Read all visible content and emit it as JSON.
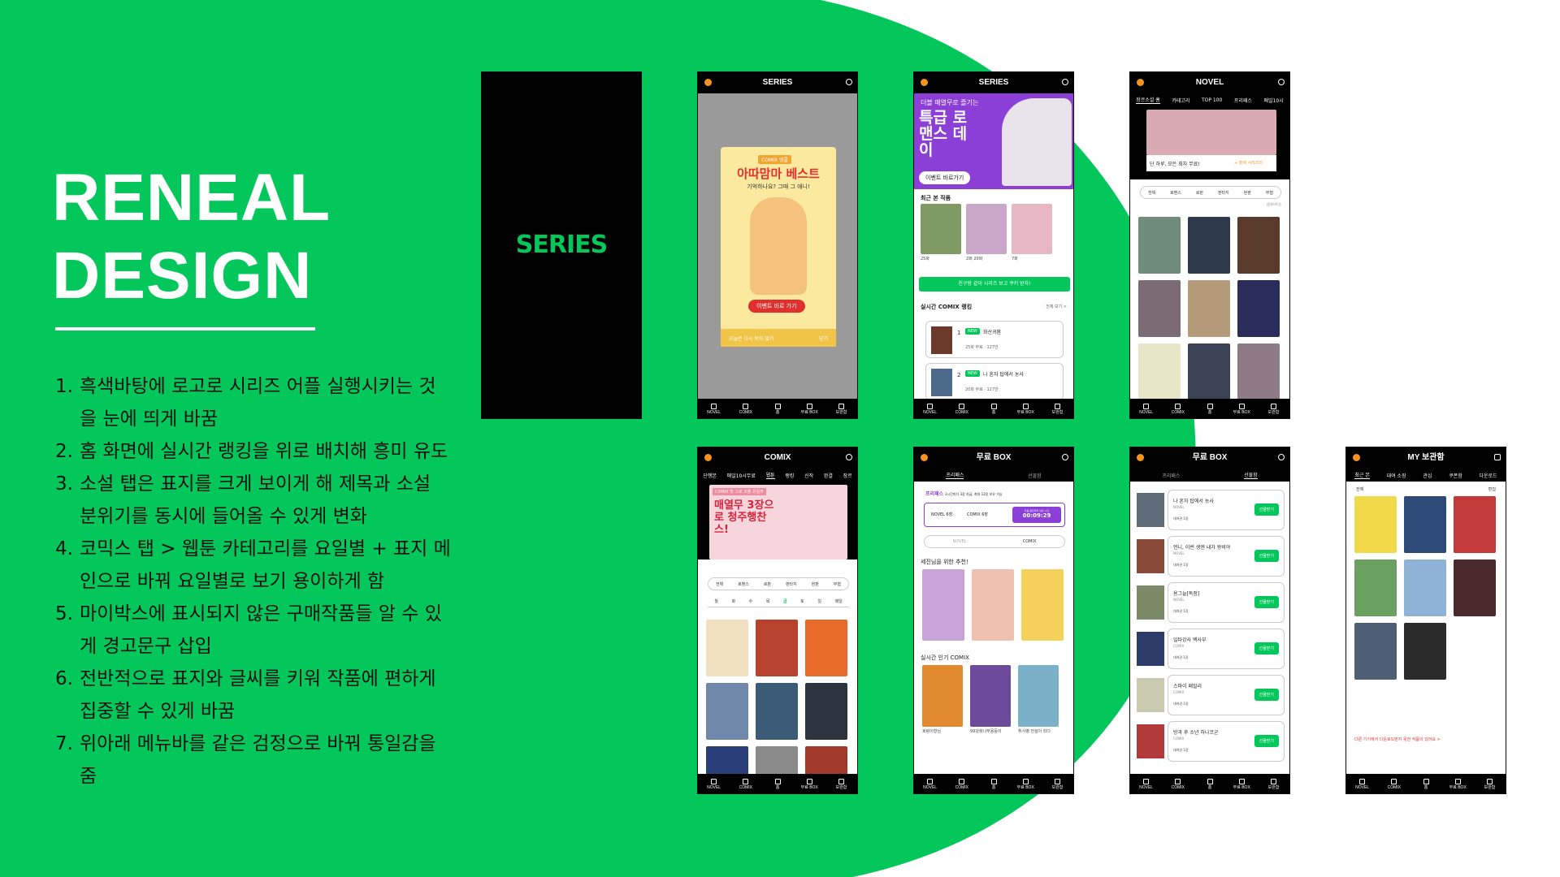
{
  "colors": {
    "brand_green": "#03c75a",
    "black": "#000000",
    "white": "#ffffff"
  },
  "title_lines": [
    "RENEAL",
    "DESIGN"
  ],
  "notes": [
    {
      "num": "1.",
      "text": "흑색바탕에  로고로 시리즈 어플 실행시키는 것 을 눈에 띄게 바꿈"
    },
    {
      "num": "2.",
      "text": "홈 화면에 실시간 랭킹을 위로 배치해 흥미 유도"
    },
    {
      "num": "3.",
      "text": "소설 탭은 표지를 크게 보이게 해 제목과 소설 분위기를 동시에 들어올 수 있게 변화"
    },
    {
      "num": "4.",
      "text": "코믹스 탭 > 웹툰 카테고리를 요일별 + 표지 메인으로 바꿔 요일별로 보기 용이하게 함"
    },
    {
      "num": "5.",
      "text": "마이박스에 표시되지 않은 구매작품들 알 수 있게 경고문구 삽입"
    },
    {
      "num": "6.",
      "text": "전반적으로 표지와 글씨를 키워 작품에 편하게 집중할 수 있게 바꿈"
    },
    {
      "num": "7.",
      "text": "위아래 메뉴바를 같은 검정으로 바꿔 통일감을 줌"
    }
  ],
  "splash_logo": "SERIES",
  "bottom_nav": [
    "NOVEL",
    "COMIX",
    "홈",
    "무료 BOX",
    "보관함"
  ],
  "screens": {
    "popup": {
      "header": "SERIES",
      "tag": "COMIX 앵콜",
      "headline": "아따맘마 베스트",
      "sub": "기억하나요? 그때 그 애니!",
      "cta": "이벤트 바로 가기",
      "footer_left": "오늘은 다시 보지 않기",
      "footer_right": "닫기"
    },
    "home": {
      "header": "SERIES",
      "banner_small": "더블 매열무로 즐기는",
      "banner_big": "특급 로맨스 데이",
      "banner_btn": "이벤트 바로가기",
      "recent_title": "최근 본 작품",
      "recent_caps": [
        "25화",
        "2화 20화",
        "7화"
      ],
      "friend_bar": "친구랑 같이 시리즈 보고 쿠키 받자!",
      "rank_title": "실시간 COMIX 랭킹",
      "rank_more": "전체 보기 >",
      "rank": [
        {
          "n": "1",
          "badge": "NEW",
          "title": "화산귀환",
          "sub": "25화 무료 · 127만"
        },
        {
          "n": "2",
          "badge": "NEW",
          "title": "나 혼자 탑에서 농사",
          "sub": "20화 무료 · 127만"
        }
      ]
    },
    "novel": {
      "header": "NOVEL",
      "tabs": [
        "장르소설 홈",
        "카테고리",
        "TOP 100",
        "프리패스",
        "매일10시"
      ],
      "banner_text": "단 하루, 모든 회차 무료!",
      "banner_btn": "+ 출제 시리즈터",
      "genres": [
        "전체",
        "로맨스",
        "로판",
        "판타지",
        "현판",
        "무협"
      ],
      "sort": "업데이트순"
    },
    "comix": {
      "header": "COMIX",
      "tabs": [
        "단행본",
        "매일10시무료",
        "웹툰",
        "랭킹",
        "신작",
        "완결",
        "장르"
      ],
      "banner_tag": "COMIX 핫 그로 코플 유일무",
      "banner_big": "매열무 3장으로 청주행찬스!",
      "genres": [
        "전체",
        "로맨스",
        "로판",
        "판타지",
        "현판",
        "무협"
      ],
      "days": [
        "월",
        "화",
        "수",
        "목",
        "금",
        "토",
        "일",
        "매일"
      ]
    },
    "freebox": {
      "header": "무료 BOX",
      "tabs": [
        "프리패스",
        "선물함"
      ],
      "info_label": "프리패스",
      "info_text": "3시간마다 3장 지급, 최대 12장 보유 가능",
      "counter_a": "NOVEL 6장",
      "counter_b": "COMIX 6장",
      "counter_timer_label": "다음 충전까지 남은 시간",
      "counter_timer": "00:09:29",
      "toggle": [
        "NOVEL",
        "COMIX"
      ],
      "rec_title": "세진님을 위한 추천!",
      "pop_title": "실시간 인기 COMIX",
      "pop_caps": [
        "호랑이형님",
        "99강화나무몽둥이",
        "취사병 전설이 되다"
      ]
    },
    "gift": {
      "header": "무료 BOX",
      "tabs": [
        "프리패스",
        "선물함"
      ],
      "items": [
        {
          "title": "나 혼자 탑에서 농사",
          "type": "NOVEL",
          "date": "대여권 1장",
          "btn": "선물받기"
        },
        {
          "title": "언니, 이번 생엔 내가 왕비야",
          "type": "NOVEL",
          "date": "대여권 1장",
          "btn": "선물받기"
        },
        {
          "title": "용그늘[독점]",
          "type": "NOVEL",
          "date": "대여권 1장",
          "btn": "선물받기"
        },
        {
          "title": "일타강사 백사부",
          "type": "COMIX",
          "date": "대여권 1장",
          "btn": "선물받기"
        },
        {
          "title": "스파이 패밀리",
          "type": "COMIX",
          "date": "대여권 1장",
          "btn": "선물받기"
        },
        {
          "title": "방과 후 소년 하나코군",
          "type": "COMIX",
          "date": "대여권 1장",
          "btn": "선물받기"
        }
      ]
    },
    "mybox": {
      "header": "MY 보관함",
      "tabs": [
        "최근 본",
        "대여 소장",
        "관심",
        "쿠폰함",
        "다운로드"
      ],
      "filter_left": "전체",
      "filter_right": "편집",
      "warning": "다른 기기에서 다운로드받지 못한 작품이 있어요 >"
    }
  }
}
